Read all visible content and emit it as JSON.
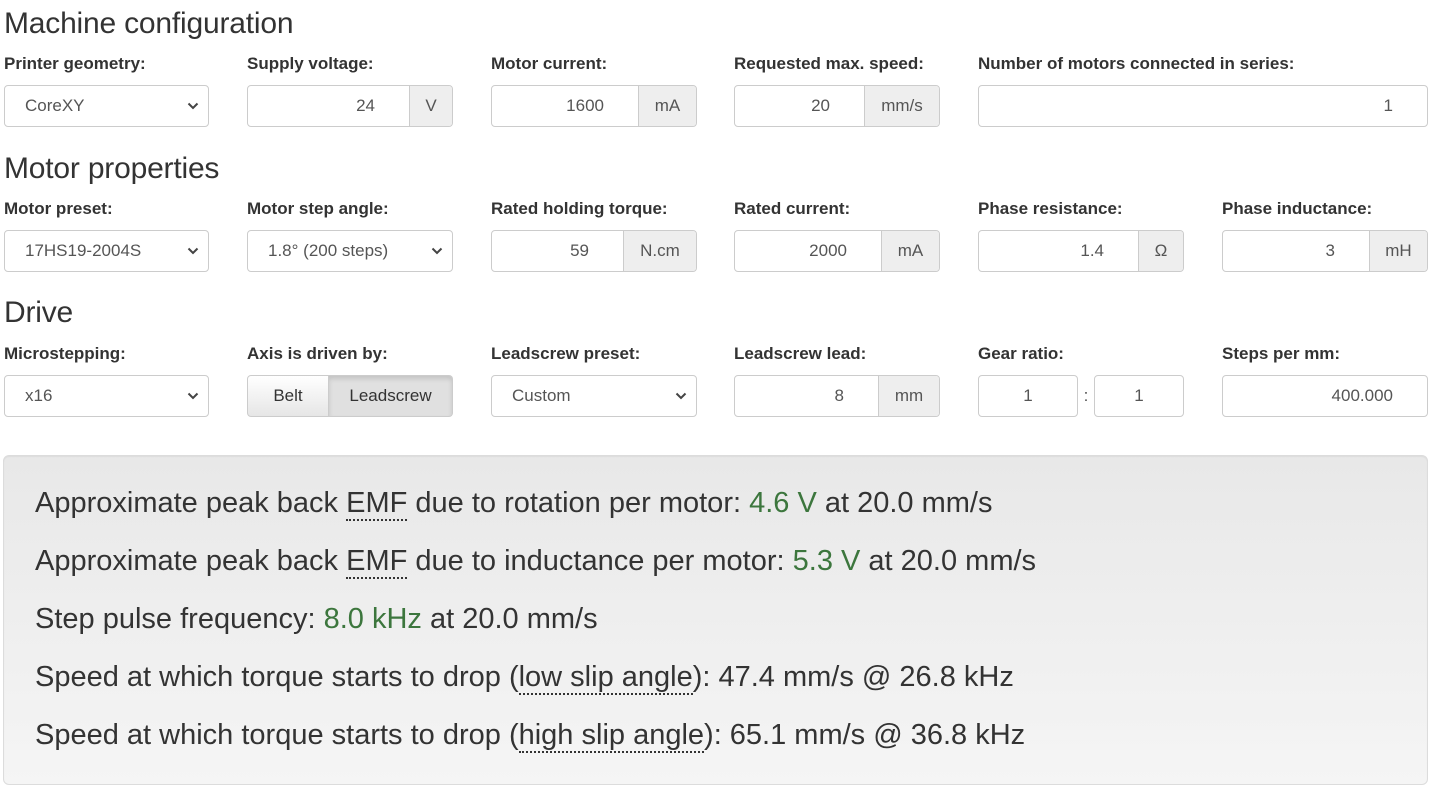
{
  "machine": {
    "title": "Machine configuration",
    "printer_geometry": {
      "label": "Printer geometry:",
      "value": "CoreXY"
    },
    "supply_voltage": {
      "label": "Supply voltage:",
      "value": "24",
      "unit": "V"
    },
    "motor_current": {
      "label": "Motor current:",
      "value": "1600",
      "unit": "mA"
    },
    "max_speed": {
      "label": "Requested max. speed:",
      "value": "20",
      "unit": "mm/s"
    },
    "motors_in_series": {
      "label": "Number of motors connected in series:",
      "value": "1"
    }
  },
  "motor": {
    "title": "Motor properties",
    "preset": {
      "label": "Motor preset:",
      "value": "17HS19-2004S"
    },
    "step_angle": {
      "label": "Motor step angle:",
      "value": "1.8° (200 steps)"
    },
    "holding_torque": {
      "label": "Rated holding torque:",
      "value": "59",
      "unit": "N.cm"
    },
    "rated_current": {
      "label": "Rated current:",
      "value": "2000",
      "unit": "mA"
    },
    "phase_resistance": {
      "label": "Phase resistance:",
      "value": "1.4",
      "unit": "Ω"
    },
    "phase_inductance": {
      "label": "Phase inductance:",
      "value": "3",
      "unit": "mH"
    }
  },
  "drive": {
    "title": "Drive",
    "microstepping": {
      "label": "Microstepping:",
      "value": "x16"
    },
    "driven_by": {
      "label": "Axis is driven by:",
      "options": [
        "Belt",
        "Leadscrew"
      ],
      "selected": "Leadscrew"
    },
    "leadscrew_preset": {
      "label": "Leadscrew preset:",
      "value": "Custom"
    },
    "leadscrew_lead": {
      "label": "Leadscrew lead:",
      "value": "8",
      "unit": "mm"
    },
    "gear_ratio": {
      "label": "Gear ratio:",
      "a": "1",
      "separator": ":",
      "b": "1"
    },
    "steps_per_mm": {
      "label": "Steps per mm:",
      "value": "400.000"
    }
  },
  "results": {
    "accent_color": "#3c763d",
    "emf_rotation": {
      "prefix": "Approximate peak back ",
      "abbr": "EMF",
      "middle": " due to rotation per motor: ",
      "value": "4.6 V",
      "suffix": " at 20.0 mm/s"
    },
    "emf_inductance": {
      "prefix": "Approximate peak back ",
      "abbr": "EMF",
      "middle": " due to inductance per motor: ",
      "value": "5.3 V",
      "suffix": " at 20.0 mm/s"
    },
    "step_freq": {
      "prefix": "Step pulse frequency: ",
      "value": "8.0 kHz",
      "suffix": " at 20.0 mm/s"
    },
    "torque_low": {
      "prefix": "Speed at which torque starts to drop (",
      "abbr": "low slip angle",
      "suffix": "): 47.4 mm/s @ 26.8 kHz"
    },
    "torque_high": {
      "prefix": "Speed at which torque starts to drop (",
      "abbr": "high slip angle",
      "suffix": "): 65.1 mm/s @ 36.8 kHz"
    }
  }
}
